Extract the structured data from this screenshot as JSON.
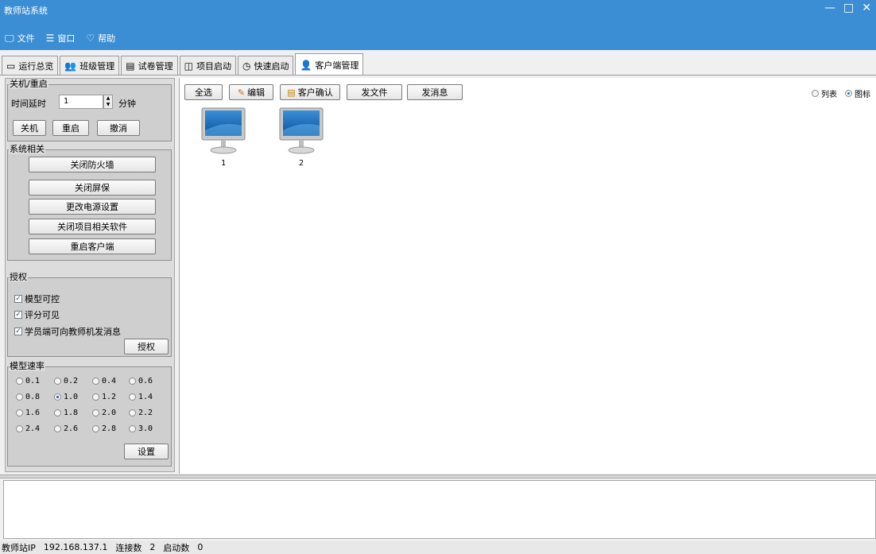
{
  "window": {
    "title": "教师站系统",
    "controls": [
      "—",
      "□",
      "✕"
    ]
  },
  "menu": [
    {
      "label": "文件",
      "icon": "monitor-icon",
      "glyph": "🖵"
    },
    {
      "label": "窗口",
      "icon": "list-icon",
      "glyph": "☰"
    },
    {
      "label": "帮助",
      "icon": "help-icon",
      "glyph": "♡"
    }
  ],
  "tabs": [
    {
      "label": "运行总览",
      "glyph": "▭"
    },
    {
      "label": "班级管理",
      "glyph": "👥"
    },
    {
      "label": "试卷管理",
      "glyph": "▤"
    },
    {
      "label": "项目启动",
      "glyph": "◫"
    },
    {
      "label": "快速启动",
      "glyph": "◷"
    },
    {
      "label": "客户端管理",
      "glyph": "👤"
    }
  ],
  "shutdown": {
    "group": "关机/重启",
    "delay_label": "时间延时",
    "delay_value": "1",
    "unit": "分钟",
    "shutdown_btn": "关机",
    "restart_btn": "重启",
    "cancel_btn": "撤消"
  },
  "system": {
    "group": "系统相关",
    "buttons": [
      "关闭防火墙",
      "关闭屏保",
      "更改电源设置",
      "关闭项目相关软件",
      "重启客户端"
    ]
  },
  "auth": {
    "group": "授权",
    "checks": [
      "模型可控",
      "评分可见",
      "学员端可向教师机发消息"
    ],
    "button": "授权"
  },
  "rate": {
    "group": "模型速率",
    "options": [
      "0.1",
      "0.2",
      "0.4",
      "0.6",
      "0.8",
      "1.0",
      "1.2",
      "1.4",
      "1.6",
      "1.8",
      "2.0",
      "2.2",
      "2.4",
      "2.6",
      "2.8",
      "3.0"
    ],
    "selected": "1.0",
    "button": "设置"
  },
  "toolbar": {
    "select_all": "全选",
    "edit": "编辑",
    "confirm": "客户确认",
    "send_file": "发文件",
    "send_msg": "发消息"
  },
  "view": {
    "list": "列表",
    "icon": "图标",
    "selected": "图标"
  },
  "clients": [
    "1",
    "2"
  ],
  "status": {
    "ip_label": "教师站IP",
    "ip": "192.168.137.1",
    "conn_label": "连接数",
    "conn": "2",
    "start_label": "启动数",
    "start": "0"
  }
}
